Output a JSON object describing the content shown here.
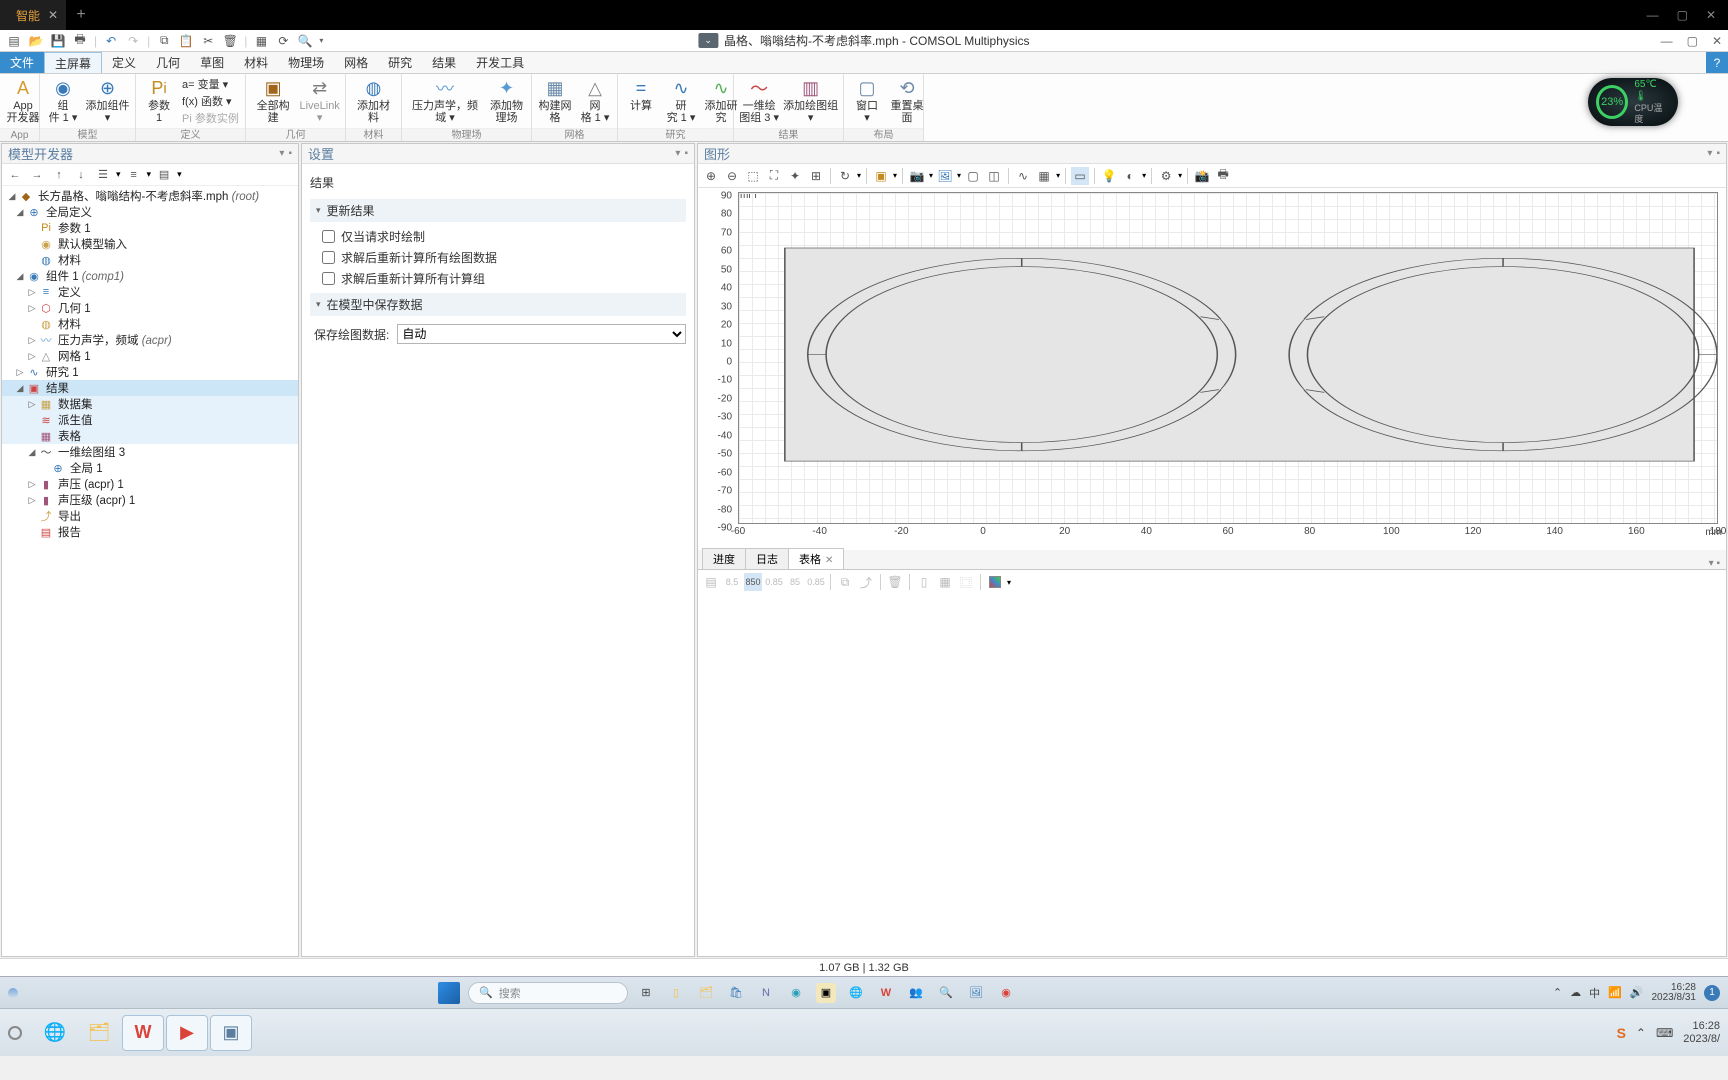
{
  "titlebar": {
    "tab_label": "智能",
    "new_tab": "+"
  },
  "app_title": "晶格、嗡嗡结构-不考虑斜率.mph - COMSOL Multiphysics",
  "menubar": [
    "文件",
    "主屏幕",
    "定义",
    "几何",
    "草图",
    "材料",
    "物理场",
    "网格",
    "研究",
    "结果",
    "开发工具"
  ],
  "ribbon": {
    "app_group": {
      "btn1": "App\n开发器",
      "label": "App"
    },
    "model_group": {
      "comp": "组\n件 1 ▾",
      "add_comp": "添加组件\n▾",
      "label": "模型"
    },
    "def_group": {
      "param": "参数\n1",
      "var": "a= 变量 ▾",
      "func": "f(x) 函数 ▾",
      "case": "Pi 参数实例",
      "label": "定义"
    },
    "geom_group": {
      "build": "全部构建",
      "live": "LiveLink\n▾",
      "label": "几何"
    },
    "mat_group": {
      "add": "添加材料",
      "label": "材料"
    },
    "phys_group": {
      "acpr": "压力声学，频域 ▾",
      "add": "添加物理场",
      "label": "物理场"
    },
    "mesh_group": {
      "build": "构建网格",
      "mesh": "网\n格 1 ▾",
      "label": "网格"
    },
    "study_group": {
      "compute": "计算",
      "study": "研\n究 1 ▾",
      "add": "添加研究",
      "label": "研究"
    },
    "result_group": {
      "plot": "一维绘\n图组 3 ▾",
      "add": "添加绘图组\n▾",
      "label": "结果"
    },
    "layout_group": {
      "win": "窗口\n▾",
      "reset": "重置桌面",
      "label": "布局"
    }
  },
  "perf": {
    "percent": "23%",
    "temp": "65℃",
    "label": "CPU温度"
  },
  "tree_panel": {
    "title": "模型开发器",
    "root": "长方晶格、嗡嗡结构-不考虑斜率.mph",
    "root_hint": "(root)",
    "global_def": "全局定义",
    "params": "参数 1",
    "default_input": "默认模型输入",
    "materials": "材料",
    "comp": "组件 1",
    "comp_hint": "(comp1)",
    "definitions": "定义",
    "geometry": "几何 1",
    "materials2": "材料",
    "physics": "压力声学，频域",
    "physics_hint": "(acpr)",
    "mesh": "网格 1",
    "study": "研究 1",
    "results": "结果",
    "dataset": "数据集",
    "derived": "派生值",
    "tables": "表格",
    "plot1d": "一维绘图组 3",
    "global1": "全局 1",
    "acpr1": "声压 (acpr) 1",
    "acpr_spl": "声压级 (acpr) 1",
    "export": "导出",
    "report": "报告"
  },
  "settings_panel": {
    "title": "设置",
    "subtitle": "结果",
    "section1": "更新结果",
    "cb1": "仅当请求时绘制",
    "cb2": "求解后重新计算所有绘图数据",
    "cb3": "求解后重新计算所有计算组",
    "section2": "在模型中保存数据",
    "field1_label": "保存绘图数据:",
    "field1_value": "自动"
  },
  "graphics_panel": {
    "title": "图形",
    "unit": "mm",
    "y_ticks": [
      "90",
      "80",
      "70",
      "60",
      "50",
      "40",
      "30",
      "20",
      "10",
      "0",
      "-10",
      "-20",
      "-30",
      "-40",
      "-50",
      "-60",
      "-70",
      "-80",
      "-90"
    ],
    "x_ticks": [
      "-60",
      "-40",
      "-20",
      "0",
      "20",
      "40",
      "60",
      "80",
      "100",
      "120",
      "140",
      "160",
      "180"
    ]
  },
  "bottom": {
    "tabs": [
      "进度",
      "日志",
      "表格"
    ],
    "active_tab_idx": 2
  },
  "status": {
    "mem": "1.07 GB | 1.32 GB"
  },
  "taskbar1": {
    "search_placeholder": "搜索",
    "time": "16:28",
    "date": "2023/8/31"
  },
  "taskbar2": {
    "time": "16:28",
    "date": "2023/8/"
  }
}
